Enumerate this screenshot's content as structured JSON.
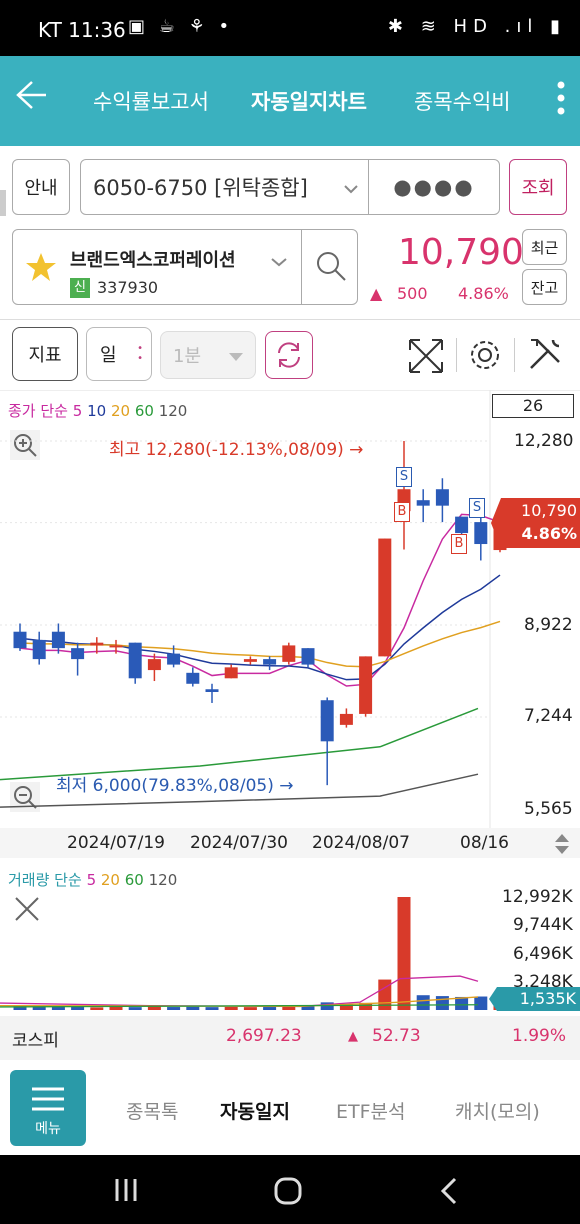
{
  "status": {
    "carrier_time": "KT 11:36",
    "left_icons": "▣ ☕ ⚘ •",
    "right_icons": "✱ ≋ HD .ıl ▮"
  },
  "header": {
    "tabs": [
      {
        "label": "수익률보고서"
      },
      {
        "label": "자동일지차트"
      },
      {
        "label": "종목수익비"
      }
    ]
  },
  "account": {
    "guide_label": "안내",
    "number": "6050-6750 [위탁종합]",
    "password_mask": "●●●●",
    "query_label": "조회"
  },
  "stock": {
    "name": "브랜드엑스코퍼레이션",
    "badge": "신",
    "code": "337930",
    "price": "10,790",
    "change": "500",
    "change_pct": "4.86%",
    "btn_recent": "최근",
    "btn_balance": "잔고"
  },
  "toolbar": {
    "indicator_label": "지표",
    "period_label": "일",
    "minute_label": "1분"
  },
  "chart": {
    "legend_prefix": "종가 단순",
    "ma": [
      {
        "label": "5",
        "color": "#c82aa0"
      },
      {
        "label": "10",
        "color": "#1f3a9a"
      },
      {
        "label": "20",
        "color": "#e0a020"
      },
      {
        "label": "60",
        "color": "#2a9a3a"
      },
      {
        "label": "120",
        "color": "#555555"
      }
    ],
    "count_box": "26",
    "y_ticks": [
      "12,280",
      "8,922",
      "7,244",
      "5,565"
    ],
    "high_note": "최고 12,280(-12.13%,08/09) →",
    "low_note": "최저 6,000(79.83%,08/05) →",
    "current_price": "10,790",
    "current_pct": "4.86%",
    "x_ticks": [
      "2024/07/19",
      "2024/07/30",
      "2024/08/07",
      "08/16"
    ],
    "signal_s": "S",
    "signal_b": "B"
  },
  "volume": {
    "legend_prefix": "거래량 단순",
    "ma": [
      {
        "label": "5",
        "color": "#c82aa0"
      },
      {
        "label": "20",
        "color": "#e0a020"
      },
      {
        "label": "60",
        "color": "#2a9a3a"
      },
      {
        "label": "120",
        "color": "#555555"
      }
    ],
    "y_ticks": [
      "12,992K",
      "9,744K",
      "6,496K",
      "3,248K"
    ],
    "current": "1,535K"
  },
  "index": {
    "name": "코스피",
    "value": "2,697.23",
    "change": "52.73",
    "pct": "1.99%"
  },
  "footer": {
    "menu_label": "메뉴",
    "tabs": [
      {
        "label": "종목톡"
      },
      {
        "label": "자동일지"
      },
      {
        "label": "ETF분석"
      },
      {
        "label": "캐치(모의)"
      }
    ]
  },
  "chart_data": {
    "type": "candlestick",
    "y_axis_ticks": [
      12280,
      8922,
      7244,
      5565
    ],
    "x_ticks": [
      "2024/07/19",
      "2024/07/30",
      "2024/08/07",
      "08/16"
    ],
    "candles": [
      {
        "o": 8800,
        "h": 8950,
        "l": 8450,
        "c": 8500
      },
      {
        "o": 8650,
        "h": 8800,
        "l": 8200,
        "c": 8300
      },
      {
        "o": 8800,
        "h": 8950,
        "l": 8400,
        "c": 8500
      },
      {
        "o": 8500,
        "h": 8600,
        "l": 8000,
        "c": 8300
      },
      {
        "o": 8550,
        "h": 8700,
        "l": 8400,
        "c": 8600
      },
      {
        "o": 8550,
        "h": 8650,
        "l": 8400,
        "c": 8550
      },
      {
        "o": 8600,
        "h": 8600,
        "l": 7850,
        "c": 7950
      },
      {
        "o": 8100,
        "h": 8400,
        "l": 7900,
        "c": 8300
      },
      {
        "o": 8400,
        "h": 8550,
        "l": 8150,
        "c": 8200
      },
      {
        "o": 8050,
        "h": 8150,
        "l": 7800,
        "c": 7850
      },
      {
        "o": 7750,
        "h": 7850,
        "l": 7500,
        "c": 7700
      },
      {
        "o": 7950,
        "h": 8200,
        "l": 7950,
        "c": 8150
      },
      {
        "o": 8250,
        "h": 8350,
        "l": 8200,
        "c": 8300
      },
      {
        "o": 8300,
        "h": 8350,
        "l": 8100,
        "c": 8200
      },
      {
        "o": 8250,
        "h": 8600,
        "l": 8200,
        "c": 8550
      },
      {
        "o": 8500,
        "h": 8500,
        "l": 8150,
        "c": 8200
      },
      {
        "o": 7550,
        "h": 7600,
        "l": 6000,
        "c": 6800
      },
      {
        "o": 7100,
        "h": 7400,
        "l": 7050,
        "c": 7300
      },
      {
        "o": 7300,
        "h": 8350,
        "l": 7250,
        "c": 8350
      },
      {
        "o": 8350,
        "h": 10500,
        "l": 8350,
        "c": 10500
      },
      {
        "o": 11000,
        "h": 12280,
        "l": 10300,
        "c": 11400
      },
      {
        "o": 11200,
        "h": 11400,
        "l": 10800,
        "c": 11100
      },
      {
        "o": 11400,
        "h": 11600,
        "l": 10800,
        "c": 11100
      },
      {
        "o": 10900,
        "h": 10900,
        "l": 10400,
        "c": 10600
      },
      {
        "o": 10800,
        "h": 10900,
        "l": 10100,
        "c": 10400
      },
      {
        "o": 10290,
        "h": 10900,
        "l": 10250,
        "c": 10790
      }
    ],
    "volume": [
      450,
      420,
      380,
      350,
      300,
      360,
      330,
      420,
      340,
      380,
      330,
      350,
      330,
      340,
      360,
      410,
      880,
      700,
      820,
      3500,
      12992,
      1700,
      1600,
      1500,
      1550,
      1535
    ]
  }
}
